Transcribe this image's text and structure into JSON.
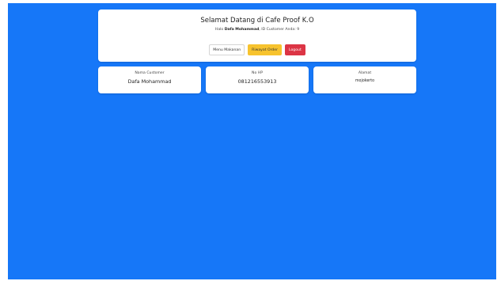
{
  "welcome": {
    "title": "Selamat Datang di Cafe Proof K.O",
    "greeting_prefix": "Halo ",
    "user_name": "Dafa Mohammad",
    "greeting_suffix": ", ID Customer Anda: 9",
    "buttons": {
      "menu": "Menu Makanan",
      "riwayat": "Riwayat Order",
      "logout": "Logout"
    }
  },
  "info": {
    "name": {
      "label": "Nama Customer",
      "value": "Dafa Mohammad"
    },
    "phone": {
      "label": "No HP",
      "value": "081216553913"
    },
    "address": {
      "label": "Alamat",
      "value": "mojokerto"
    }
  },
  "colors": {
    "background": "#1677f8",
    "card": "#ffffff",
    "riwayat_button": "#f7c32e",
    "logout_button": "#dc3545"
  }
}
